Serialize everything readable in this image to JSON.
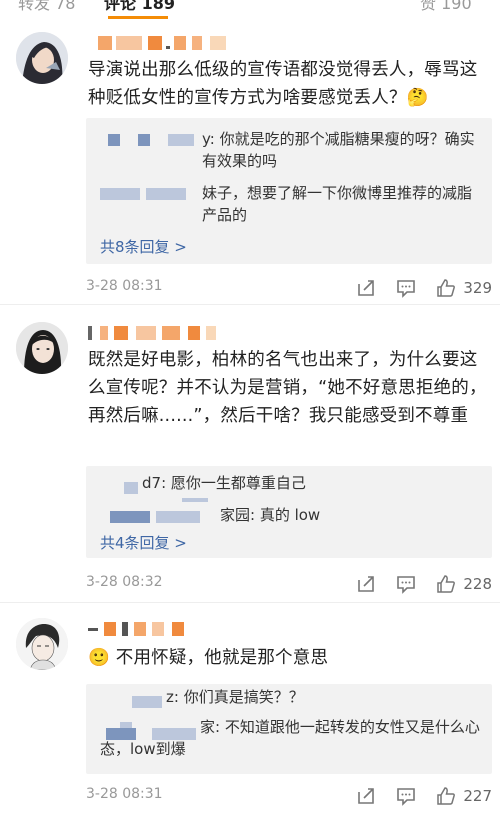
{
  "tabs": {
    "repost": "转发 78",
    "comments": "评论 189",
    "likes": "赞 190"
  },
  "comments": [
    {
      "text": "导演说出那么低级的宣传语都没觉得丢人，辱骂这种贬低女性的宣传方式为啥要感觉丢人？🤔",
      "replies": [
        {
          "text": "y: 你就是吃的那个减脂糖果瘦的呀？确实有效果的吗"
        },
        {
          "text": "妹子，想要了解一下你微博里推荐的减脂产品的"
        }
      ],
      "more": "共8条回复 >",
      "time": "3-28 08:31",
      "likes": "329"
    },
    {
      "text": "既然是好电影，柏林的名气也出来了，为什么要这么宣传呢？并不认为是营销，“她不好意思拒绝的，再然后嘛......”，然后干啥？我只能感受到不尊重",
      "replies": [
        {
          "text": "d7: 愿你一生都尊重自己"
        },
        {
          "text": "家园: 真的 low"
        }
      ],
      "more": "共4条回复 >",
      "time": "3-28 08:32",
      "likes": "228"
    },
    {
      "text": "🙂 不用怀疑，他就是那个意思",
      "replies": [
        {
          "text": "z: 你们真是搞笑？？"
        },
        {
          "text": "家: 不知道跟他一起转发的女性又是什么心态，low到爆"
        }
      ],
      "time": "3-28 08:31",
      "likes": "227"
    }
  ],
  "icons": [
    "repost-icon",
    "comment-icon",
    "like-icon"
  ]
}
